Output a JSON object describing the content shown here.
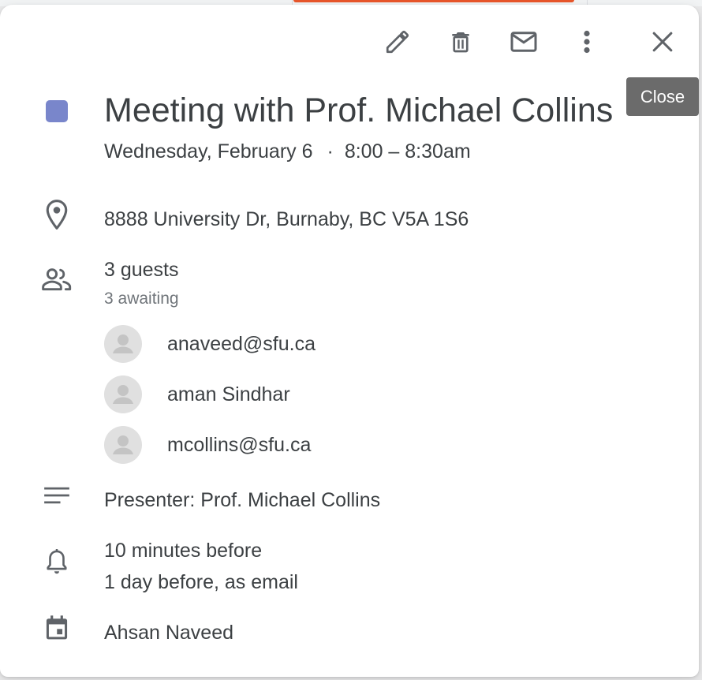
{
  "toolbar": {
    "edit_icon": "pencil-icon",
    "delete_icon": "trash-icon",
    "email_icon": "envelope-icon",
    "more_icon": "more-vert-icon",
    "close_icon": "close-icon"
  },
  "tooltip": {
    "label": "Close"
  },
  "event": {
    "color": "#7986cb",
    "title": "Meeting with Prof. Michael Collins",
    "date": "Wednesday, February 6",
    "separator": "·",
    "time": "8:00 – 8:30am"
  },
  "location": {
    "icon": "location-pin-icon",
    "text": "8888 University Dr, Burnaby, BC V5A 1S6"
  },
  "guests": {
    "icon": "people-icon",
    "count_label": "3 guests",
    "status_label": "3 awaiting",
    "list": [
      {
        "name": "anaveed@sfu.ca"
      },
      {
        "name": "aman Sindhar"
      },
      {
        "name": "mcollins@sfu.ca"
      }
    ]
  },
  "description": {
    "icon": "notes-icon",
    "text": "Presenter: Prof. Michael Collins"
  },
  "notifications": {
    "icon": "bell-icon",
    "items": [
      "10 minutes before",
      "1 day before, as email"
    ]
  },
  "calendar": {
    "icon": "calendar-icon",
    "owner": "Ahsan Naveed"
  },
  "colors": {
    "icon": "#5f6368",
    "text": "#3c4043",
    "secondary": "#70757a",
    "avatar_bg": "#e0e0e0",
    "tooltip_bg": "#6b6b6b"
  }
}
